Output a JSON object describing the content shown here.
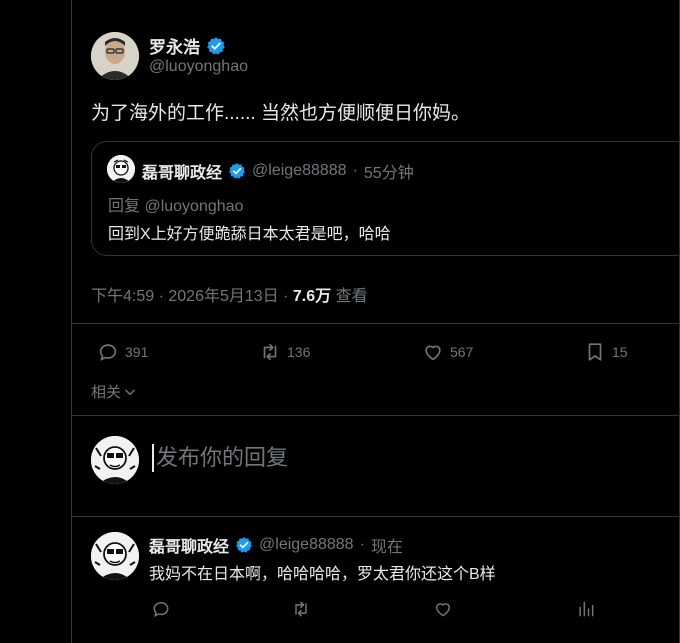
{
  "tweet": {
    "author_name": "罗永浩",
    "author_handle": "@luoyonghao",
    "text": "为了海外的工作...... 当然也方便顺便日你妈。",
    "quote": {
      "name": "磊哥聊政经",
      "handle": "@leige88888",
      "time": "55分钟",
      "reply_to": "回复 @luoyonghao",
      "text": "回到X上好方便跪舔日本太君是吧，哈哈"
    },
    "time": "下午4:59",
    "date": "2026年5月13日",
    "views_count": "7.6万",
    "views_label": "查看",
    "stats": {
      "replies": "391",
      "retweets": "136",
      "likes": "567",
      "bookmarks": "15"
    }
  },
  "related_label": "相关",
  "compose": {
    "placeholder": "发布你的回复"
  },
  "reply": {
    "name": "磊哥聊政经",
    "handle": "@leige88888",
    "time": "现在",
    "text": "我妈不在日本啊，哈哈哈哈，罗太君你还这个B样"
  },
  "colors": {
    "verified": "#1d9bf0",
    "muted": "#71767b",
    "text": "#e7e9ea",
    "border": "#2f3336"
  },
  "icons": [
    "reply-icon",
    "retweet-icon",
    "like-icon",
    "bookmark-icon",
    "views-icon",
    "verified-icon",
    "chevron-down-icon"
  ]
}
